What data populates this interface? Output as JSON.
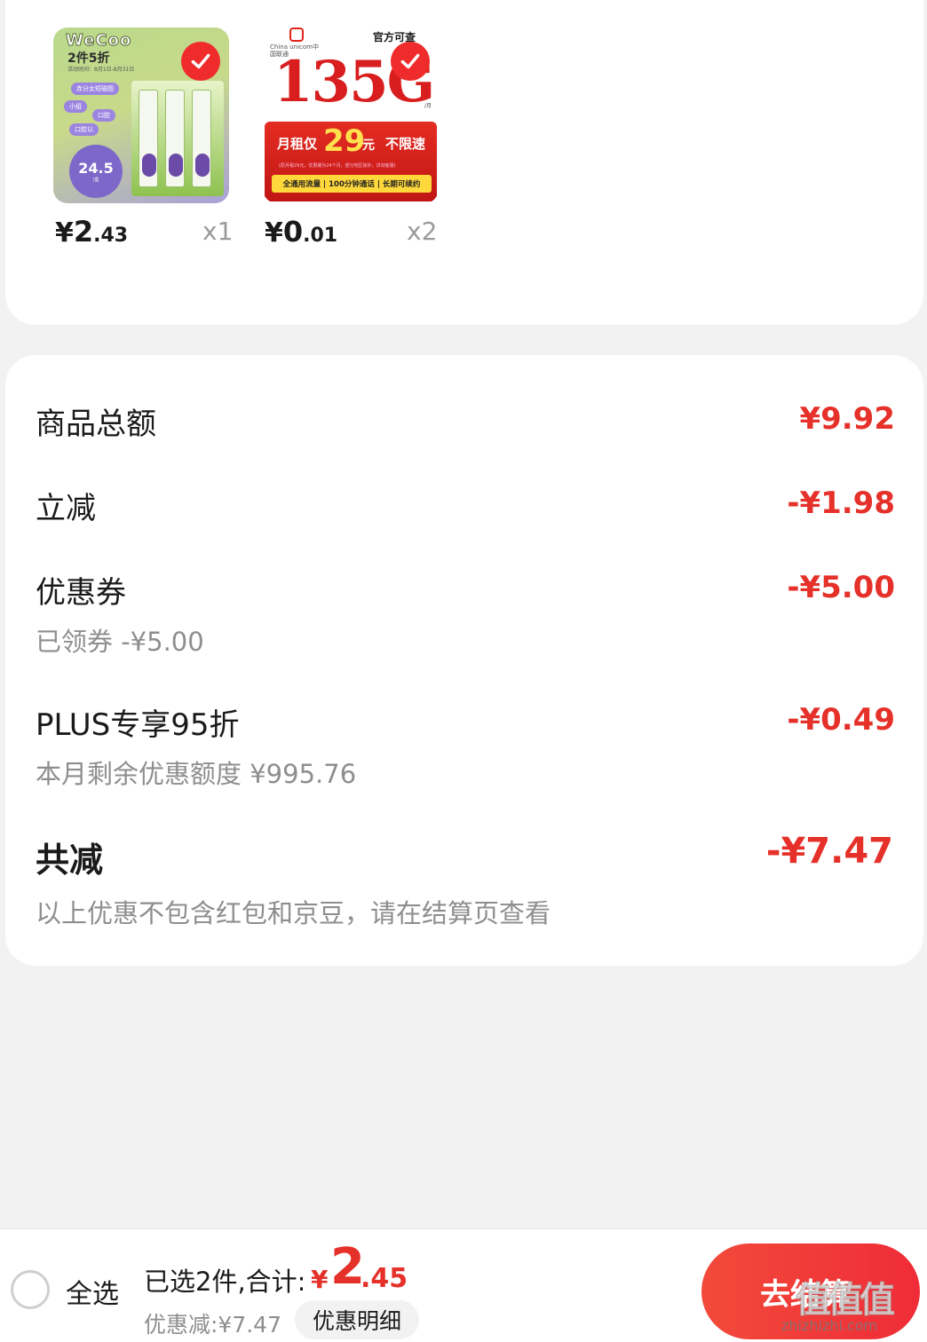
{
  "products": [
    {
      "image": {
        "brand": "WeCoo",
        "promo": "2件5折",
        "date": "活动时间：8月1日-8月31日",
        "tags": [
          "赤分女短磁图",
          "小组",
          "口腔",
          "口腔以"
        ],
        "price_big": "24.5",
        "price_unit": "/盒"
      },
      "price_yen": "¥",
      "price_int": "2",
      "price_dec": ".43",
      "qty": "x1",
      "selected": true
    },
    {
      "image": {
        "carrier": "China unicom中国联通",
        "official": "官方可查",
        "big": "135G",
        "unit": "/月",
        "rent_label": "月租仅",
        "rent_num": "29",
        "rent_yuan": "元",
        "unlimited": "不限速",
        "note": "(原月租29元，优惠期为24个月，部分地区除外，详询客服)",
        "strip": "全通用流量 | 100分钟通话 | 长期可续约"
      },
      "price_yen": "¥",
      "price_int": "0",
      "price_dec": ".01",
      "qty": "x2",
      "selected": true
    }
  ],
  "summary": {
    "goods_total_label": "商品总额",
    "goods_total_value": "¥9.92",
    "instant_cut_label": "立减",
    "instant_cut_value": "-¥1.98",
    "coupon_label": "优惠券",
    "coupon_value": "-¥5.00",
    "coupon_sub": "已领券 -¥5.00",
    "plus_label": "PLUS专享95折",
    "plus_value": "-¥0.49",
    "plus_sub": "本月剩余优惠额度 ¥995.76",
    "total_cut_label": "共减",
    "total_cut_value": "-¥7.47",
    "total_cut_note": "以上优惠不包含红包和京豆，请在结算页查看"
  },
  "bottom": {
    "select_all": "全选",
    "selected_count_text": "已选2件,合计:",
    "total_yen": "¥",
    "total_int": "2",
    "total_dec": ".45",
    "discount_text": "优惠减:¥7.47",
    "detail_button": "优惠明细",
    "checkout_button": "去结算",
    "watermark_logo": "值值值",
    "watermark_url": "zhizhizhi.com"
  },
  "colors": {
    "accent_red": "#e5312a",
    "background": "#f2f2f2",
    "card": "#ffffff"
  }
}
